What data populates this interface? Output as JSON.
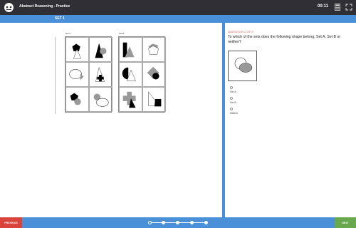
{
  "header": {
    "app_title": "Abstract Reasoning - Practice",
    "timer": "00:11",
    "icons": [
      "logo-icon",
      "calculator-icon",
      "fullscreen-icon"
    ]
  },
  "subheader": {
    "tab_label": "SET 1"
  },
  "sets": {
    "set_a_label": "Set A",
    "set_b_label": "Set B"
  },
  "question": {
    "number_label": "QUESTION 1 OF 5",
    "text": "To which of the sets does the following shape belong, Set A, Set B or neither?",
    "options": [
      {
        "label": "Set A"
      },
      {
        "label": "Set B"
      },
      {
        "label": "Neither"
      }
    ]
  },
  "footer": {
    "prev_label": "PREVIOUS",
    "next_label": "NEXT",
    "progress_total": 5,
    "progress_current": 1
  },
  "colors": {
    "header_bg": "#2f2f35",
    "accent_blue": "#4a90d9",
    "prev_red": "#d9453c",
    "next_green": "#6aa84f",
    "question_number": "#d9534f"
  }
}
